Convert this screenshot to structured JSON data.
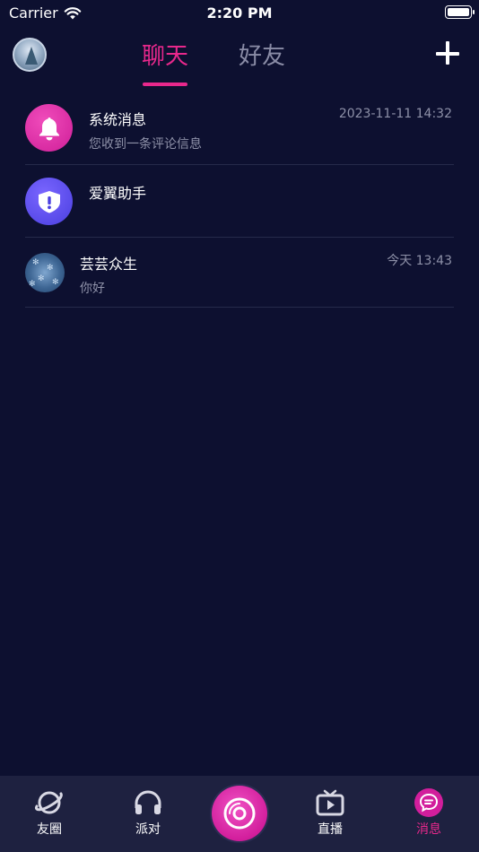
{
  "status_bar": {
    "carrier": "Carrier",
    "time": "2:20 PM"
  },
  "header": {
    "tabs": [
      {
        "label": "聊天",
        "active": true
      },
      {
        "label": "好友",
        "active": false
      }
    ],
    "add_icon": "plus-icon"
  },
  "conversations": [
    {
      "name": "系统消息",
      "preview": "您收到一条评论信息",
      "time": "2023-11-11 14:32",
      "icon": "bell-icon",
      "color": "#e22aa6"
    },
    {
      "name": "爱翼助手",
      "preview": "",
      "time": "",
      "icon": "alert-shield-icon",
      "color": "#5a4cf0"
    },
    {
      "name": "芸芸众生",
      "preview": "你好",
      "time": "今天 13:43",
      "icon": "avatar-image",
      "color": "#3d6593"
    }
  ],
  "bottom_nav": {
    "items": [
      {
        "label": "友圈",
        "icon": "planet-icon"
      },
      {
        "label": "派对",
        "icon": "headphones-icon"
      },
      {
        "label": "直播",
        "icon": "tv-play-icon"
      },
      {
        "label": "消息",
        "icon": "chat-bubble-icon",
        "active": true
      }
    ],
    "center_icon": "record-icon"
  },
  "colors": {
    "background": "#0d1030",
    "accent": "#e8288c",
    "nav_background": "#1e2140",
    "muted_text": "#8e91a8"
  }
}
